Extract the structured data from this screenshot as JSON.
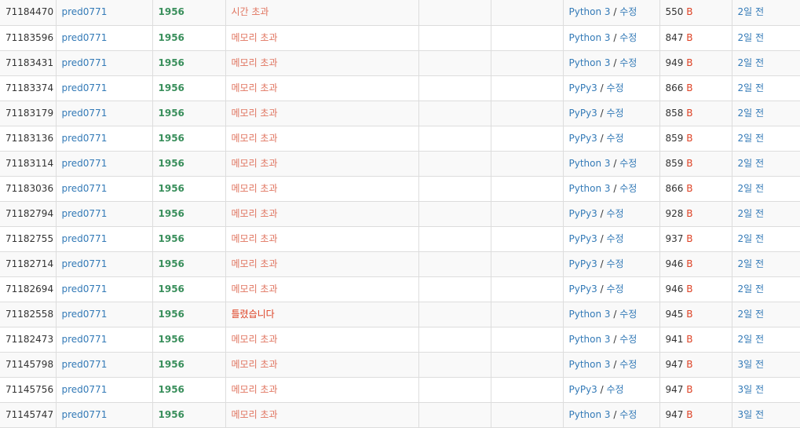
{
  "colors": {
    "link": "#337ab7",
    "problem": "#3a8f5c",
    "result_wrong": "#dd4124",
    "result_limit": "#e0745f",
    "row_stripe": "#f9f9f9",
    "border": "#dddddd"
  },
  "edit_label": "수정",
  "slash": " / ",
  "byte_unit": "B",
  "rows": [
    {
      "id": "71184470",
      "user": "pred0771",
      "problem": "1956",
      "result": "시간 초과",
      "result_type": "tle",
      "lang": "Python 3",
      "code_len": "550",
      "time": "2일 전"
    },
    {
      "id": "71183596",
      "user": "pred0771",
      "problem": "1956",
      "result": "메모리 초과",
      "result_type": "mle",
      "lang": "Python 3",
      "code_len": "847",
      "time": "2일 전"
    },
    {
      "id": "71183431",
      "user": "pred0771",
      "problem": "1956",
      "result": "메모리 초과",
      "result_type": "mle",
      "lang": "Python 3",
      "code_len": "949",
      "time": "2일 전"
    },
    {
      "id": "71183374",
      "user": "pred0771",
      "problem": "1956",
      "result": "메모리 초과",
      "result_type": "mle",
      "lang": "PyPy3",
      "code_len": "866",
      "time": "2일 전"
    },
    {
      "id": "71183179",
      "user": "pred0771",
      "problem": "1956",
      "result": "메모리 초과",
      "result_type": "mle",
      "lang": "PyPy3",
      "code_len": "858",
      "time": "2일 전"
    },
    {
      "id": "71183136",
      "user": "pred0771",
      "problem": "1956",
      "result": "메모리 초과",
      "result_type": "mle",
      "lang": "PyPy3",
      "code_len": "859",
      "time": "2일 전"
    },
    {
      "id": "71183114",
      "user": "pred0771",
      "problem": "1956",
      "result": "메모리 초과",
      "result_type": "mle",
      "lang": "Python 3",
      "code_len": "859",
      "time": "2일 전"
    },
    {
      "id": "71183036",
      "user": "pred0771",
      "problem": "1956",
      "result": "메모리 초과",
      "result_type": "mle",
      "lang": "Python 3",
      "code_len": "866",
      "time": "2일 전"
    },
    {
      "id": "71182794",
      "user": "pred0771",
      "problem": "1956",
      "result": "메모리 초과",
      "result_type": "mle",
      "lang": "PyPy3",
      "code_len": "928",
      "time": "2일 전"
    },
    {
      "id": "71182755",
      "user": "pred0771",
      "problem": "1956",
      "result": "메모리 초과",
      "result_type": "mle",
      "lang": "PyPy3",
      "code_len": "937",
      "time": "2일 전"
    },
    {
      "id": "71182714",
      "user": "pred0771",
      "problem": "1956",
      "result": "메모리 초과",
      "result_type": "mle",
      "lang": "PyPy3",
      "code_len": "946",
      "time": "2일 전"
    },
    {
      "id": "71182694",
      "user": "pred0771",
      "problem": "1956",
      "result": "메모리 초과",
      "result_type": "mle",
      "lang": "PyPy3",
      "code_len": "946",
      "time": "2일 전"
    },
    {
      "id": "71182558",
      "user": "pred0771",
      "problem": "1956",
      "result": "틀렸습니다",
      "result_type": "wrong",
      "lang": "Python 3",
      "code_len": "945",
      "time": "2일 전"
    },
    {
      "id": "71182473",
      "user": "pred0771",
      "problem": "1956",
      "result": "메모리 초과",
      "result_type": "mle",
      "lang": "Python 3",
      "code_len": "941",
      "time": "2일 전"
    },
    {
      "id": "71145798",
      "user": "pred0771",
      "problem": "1956",
      "result": "메모리 초과",
      "result_type": "mle",
      "lang": "Python 3",
      "code_len": "947",
      "time": "3일 전"
    },
    {
      "id": "71145756",
      "user": "pred0771",
      "problem": "1956",
      "result": "메모리 초과",
      "result_type": "mle",
      "lang": "PyPy3",
      "code_len": "947",
      "time": "3일 전"
    },
    {
      "id": "71145747",
      "user": "pred0771",
      "problem": "1956",
      "result": "메모리 초과",
      "result_type": "mle",
      "lang": "Python 3",
      "code_len": "947",
      "time": "3일 전"
    }
  ]
}
